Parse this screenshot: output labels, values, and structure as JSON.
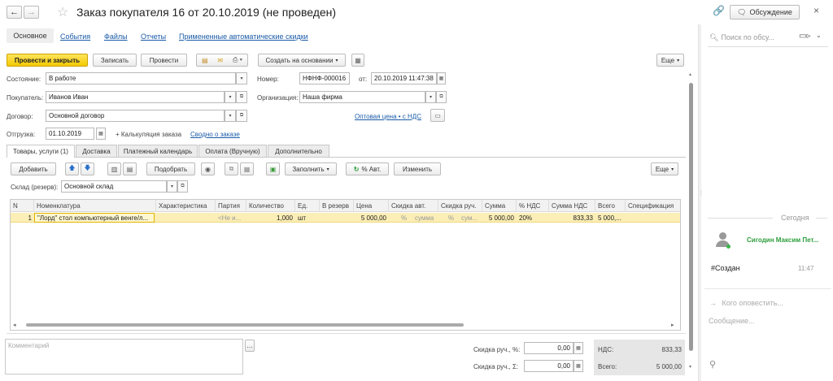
{
  "window": {
    "title": "Заказ покупателя 16 от 20.10.2019 (не проведен)",
    "discussion_label": "Обсуждение",
    "close_glyph": "×"
  },
  "nav_tabs": [
    {
      "label": "Основное"
    },
    {
      "label": "События"
    },
    {
      "label": "Файлы"
    },
    {
      "label": "Отчеты"
    },
    {
      "label": "Примененные автоматические скидки"
    }
  ],
  "toolbar": {
    "post_close": "Провести и закрыть",
    "save": "Записать",
    "post": "Провести",
    "create_based": "Создать на основании",
    "more": "Еще"
  },
  "header_fields": {
    "state_label": "Состояние:",
    "state_value": "В работе",
    "number_label": "Номер:",
    "number_value": "НФНФ-000016",
    "from_label": "от:",
    "date_value": "20.10.2019 11:47:38",
    "customer_label": "Покупатель:",
    "customer_value": "Иванов Иван",
    "org_label": "Организация:",
    "org_value": "Наша фирма",
    "contract_label": "Договор:",
    "contract_value": "Основной договор",
    "price_link": "Оптовая цена • с НДС",
    "shipment_label": "Отгрузка:",
    "shipment_value": "01.10.2019",
    "calc_label": "+ Калькуляция заказа",
    "summary_link": "Сводно о заказе"
  },
  "doc_tabs": [
    {
      "label": "Товары, услуги (1)"
    },
    {
      "label": "Доставка"
    },
    {
      "label": "Платежный календарь"
    },
    {
      "label": "Оплата (Вручную)"
    },
    {
      "label": "Дополнительно"
    }
  ],
  "table_toolbar": {
    "add": "Добавить",
    "pick": "Подобрать",
    "fill": "Заполнить",
    "auto_pct": "% Авт.",
    "change": "Изменить",
    "more": "Еще"
  },
  "warehouse": {
    "label": "Склад (резерв):",
    "value": "Основной склад"
  },
  "table": {
    "headers": [
      "N",
      "Номенклатура",
      "Характеристика",
      "Партия",
      "Количество",
      "Ед.",
      "В резерв",
      "Цена",
      "Скидка авт.",
      "Скидка руч.",
      "Сумма",
      "% НДС",
      "Сумма НДС",
      "Всего",
      "Спецификация"
    ],
    "rows": [
      {
        "n": "1",
        "item": "\"Лорд\" стол компьютерный венге/л...",
        "char": "",
        "batch": "<Не и...",
        "qty": "1,000",
        "unit": "шт",
        "reserve": "",
        "price": "5 000,00",
        "disc_auto_pct": "%",
        "disc_auto_sum": "сумма",
        "disc_man_pct": "%",
        "disc_man_sum": "сум...",
        "sum": "5 000,00",
        "vat_rate": "20%",
        "vat_sum": "833,33",
        "total": "5 000,...",
        "spec": ""
      }
    ]
  },
  "footer": {
    "comment_placeholder": "Комментарий",
    "disc_pct_label": "Скидка руч., %:",
    "disc_pct_value": "0,00",
    "disc_sum_label": "Скидка руч., Σ:",
    "disc_sum_value": "0,00",
    "vat_label": "НДС:",
    "vat_value": "833,33",
    "total_label": "Всего:",
    "total_value": "5 000,00"
  },
  "discussion": {
    "search_placeholder": "Поиск по обсу...",
    "today": "Сегодня",
    "user": "Сигодин Максим Пет...",
    "message": "#Создан",
    "time": "11:47",
    "notify_placeholder": "Кого оповестить...",
    "message_placeholder": "Сообщение..."
  }
}
